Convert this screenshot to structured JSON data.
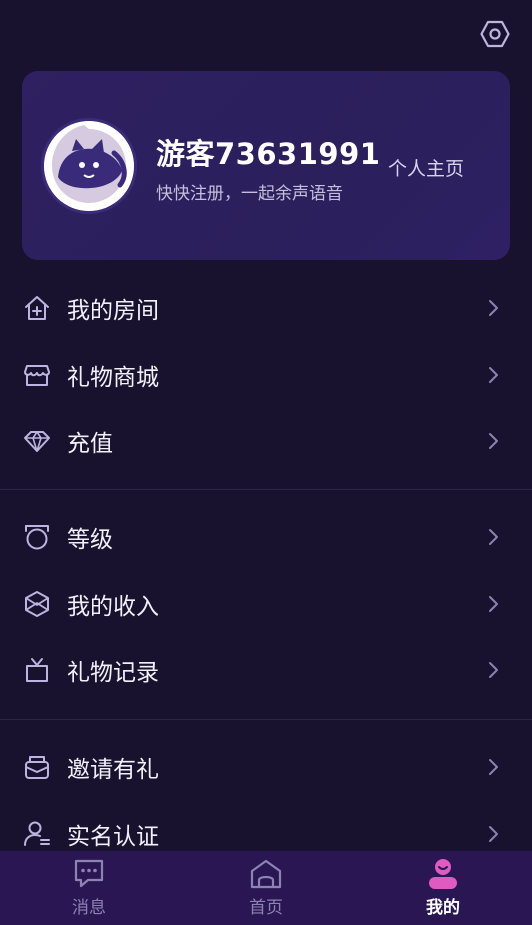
{
  "header": {
    "settings_icon": "settings-hexagon-icon"
  },
  "profile": {
    "username": "游客73631991",
    "subtitle": "快快注册，一起余声语音",
    "homepage_label": "个人主页",
    "avatar_icon": "cat-avatar"
  },
  "menu_groups": [
    {
      "items": [
        {
          "label": "我的房间",
          "icon": "house-icon"
        },
        {
          "label": "礼物商城",
          "icon": "store-icon"
        },
        {
          "label": "充值",
          "icon": "diamond-icon"
        }
      ]
    },
    {
      "items": [
        {
          "label": "等级",
          "icon": "level-badge-icon"
        },
        {
          "label": "我的收入",
          "icon": "income-icon"
        },
        {
          "label": "礼物记录",
          "icon": "gift-icon"
        }
      ]
    },
    {
      "items": [
        {
          "label": "邀请有礼",
          "icon": "invite-icon"
        },
        {
          "label": "实名认证",
          "icon": "user-verify-icon"
        }
      ]
    }
  ],
  "tabs": [
    {
      "label": "消息",
      "icon": "message-icon",
      "active": false
    },
    {
      "label": "首页",
      "icon": "home-icon",
      "active": false
    },
    {
      "label": "我的",
      "icon": "profile-icon",
      "active": true
    }
  ],
  "colors": {
    "background": "#19122e",
    "card": "#2d1f5e",
    "tab_bar": "#2b1654",
    "accent_pink": "#e05bbf",
    "icon_stroke": "#bdb5e0"
  }
}
